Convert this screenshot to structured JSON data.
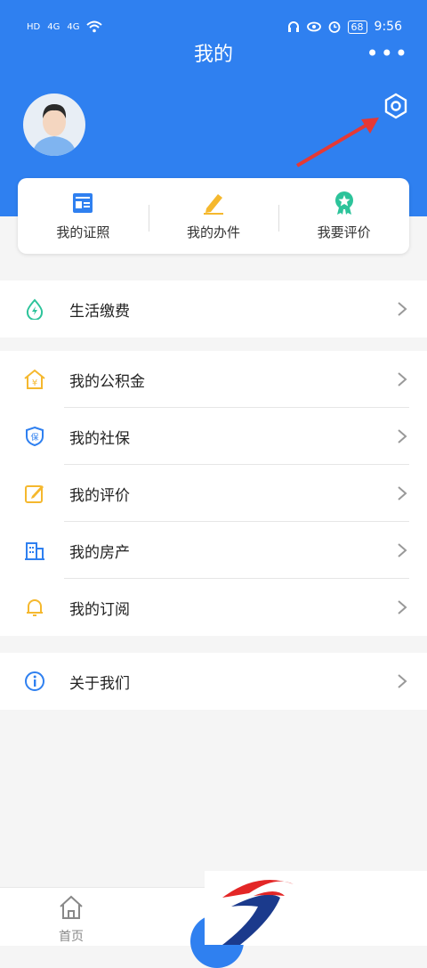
{
  "status_bar": {
    "left_tags": [
      "HD",
      "4G",
      "4G"
    ],
    "battery": "68",
    "time": "9:56"
  },
  "header": {
    "title": "我的",
    "more_icon": "more-dots-icon",
    "settings_icon": "gear-icon",
    "annotation": "red-arrow-pointing-to-settings"
  },
  "quick_actions": [
    {
      "label": "我的证照",
      "icon": "id-card-icon",
      "color": "#2f80f0"
    },
    {
      "label": "我的办件",
      "icon": "pencil-icon",
      "color": "#f5b82e"
    },
    {
      "label": "我要评价",
      "icon": "badge-star-icon",
      "color": "#2cc39a"
    }
  ],
  "menu_groups": [
    [
      {
        "label": "生活缴费",
        "icon": "water-drop-icon",
        "color": "#2cc39a"
      }
    ],
    [
      {
        "label": "我的公积金",
        "icon": "house-yen-icon",
        "color": "#f5b82e"
      },
      {
        "label": "我的社保",
        "icon": "shield-bao-icon",
        "color": "#2f80f0"
      },
      {
        "label": "我的评价",
        "icon": "edit-icon",
        "color": "#f5b82e"
      },
      {
        "label": "我的房产",
        "icon": "building-icon",
        "color": "#2f80f0"
      },
      {
        "label": "我的订阅",
        "icon": "bell-icon",
        "color": "#f5b82e"
      }
    ],
    [
      {
        "label": "关于我们",
        "icon": "info-icon",
        "color": "#2f80f0"
      }
    ]
  ],
  "tab_bar": {
    "home_label": "首页"
  },
  "colors": {
    "primary": "#2f80f0",
    "background": "#f5f5f5"
  }
}
